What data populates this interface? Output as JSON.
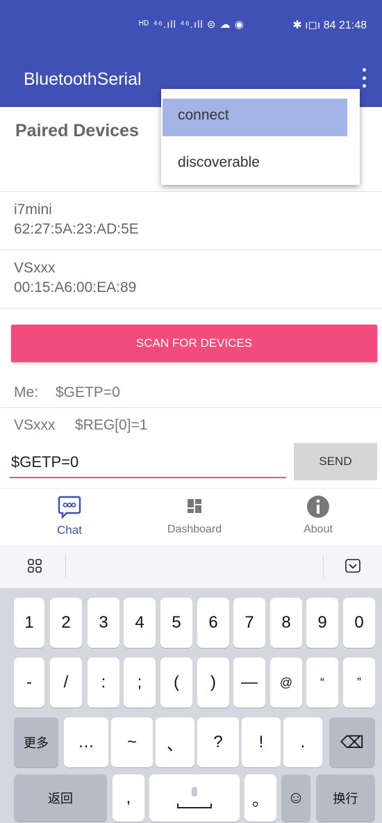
{
  "status_bar": {
    "signal_text": "ᴴᴰ ⁴⁶.ıll ⁴⁶.ıll ⊜ ☁ ◉",
    "right_text": "✱ ı◻ı 84 21:48"
  },
  "app_bar": {
    "title": "BluetoothSerial"
  },
  "menu": {
    "items": [
      {
        "label": "connect"
      },
      {
        "label": "discoverable"
      }
    ]
  },
  "paired": {
    "header": "Paired Devices",
    "devices": [
      {
        "name": "i7mini",
        "address": "62:27:5A:23:AD:5E"
      },
      {
        "name": "VSxxx",
        "address": "00:15:A6:00:EA:89"
      }
    ]
  },
  "scan_button": "SCAN FOR DEVICES",
  "messages": [
    {
      "sender": "Me:",
      "text": "$GETP=0"
    },
    {
      "sender": "VSxxx",
      "text": "$REG[0]=1"
    }
  ],
  "input": {
    "value": "$GETP=0"
  },
  "send_button": "SEND",
  "bottom_nav": [
    {
      "label": "Chat",
      "icon": "chat-bubble-icon",
      "active": true
    },
    {
      "label": "Dashboard",
      "icon": "dashboard-icon",
      "active": false
    },
    {
      "label": "About",
      "icon": "info-icon",
      "active": false
    }
  ],
  "keyboard": {
    "row1": [
      "1",
      "2",
      "3",
      "4",
      "5",
      "6",
      "7",
      "8",
      "9",
      "0"
    ],
    "row2": [
      "-",
      "/",
      ":",
      ";",
      "(",
      ")",
      "—",
      "@",
      "“",
      "”"
    ],
    "row3": {
      "more": "更多",
      "keys": [
        "…",
        "~",
        "、",
        "?",
        "!",
        "."
      ],
      "backspace": "⌫"
    },
    "row4": {
      "back": "返回",
      "comma": ",",
      "period": "。",
      "emoji": "☺",
      "newline": "换行"
    }
  },
  "colors": {
    "primary": "#3f51b5",
    "accent": "#f24c7c",
    "menu_highlight": "#a5b4e6"
  }
}
